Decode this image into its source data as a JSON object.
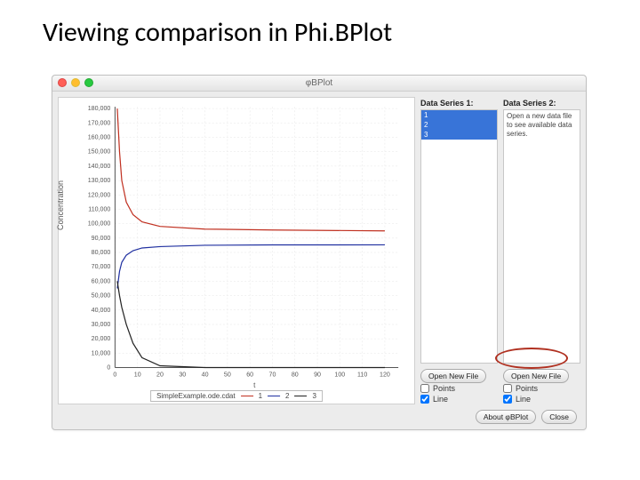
{
  "slide": {
    "title": "Viewing comparison in Phi.BPlot"
  },
  "window": {
    "title": "φBPlot"
  },
  "chart_data": {
    "type": "line",
    "title": "",
    "xlabel": "t",
    "ylabel": "Concentration",
    "xlim": [
      0,
      130
    ],
    "ylim": [
      0,
      180000
    ],
    "xticks": [
      0,
      10,
      20,
      30,
      40,
      50,
      60,
      70,
      80,
      90,
      100,
      110,
      120
    ],
    "yticks": [
      0,
      10,
      20,
      30,
      40,
      50,
      60,
      70,
      80,
      90,
      100,
      110,
      120,
      130,
      140,
      150,
      160,
      170,
      180
    ],
    "ytick_labels": [
      "0",
      "10,000",
      "20,000",
      "30,000",
      "40,000",
      "50,000",
      "60,000",
      "70,000",
      "80,000",
      "90,000",
      "100,000",
      "110,000",
      "120,000",
      "130,000",
      "140,000",
      "150,000",
      "160,000",
      "170,000",
      "180,000"
    ],
    "series": [
      {
        "name": "1",
        "color": "#c03020",
        "x": [
          1,
          2,
          3,
          5,
          8,
          12,
          20,
          40,
          70,
          120
        ],
        "y": [
          180000,
          150000,
          130000,
          115000,
          106000,
          101000,
          98000,
          96000,
          95500,
          95000
        ]
      },
      {
        "name": "2",
        "color": "#2030a0",
        "x": [
          1,
          2,
          3,
          5,
          8,
          12,
          20,
          40,
          70,
          120
        ],
        "y": [
          55000,
          67000,
          73000,
          78000,
          81000,
          83000,
          84000,
          85000,
          85200,
          85300
        ]
      },
      {
        "name": "3",
        "color": "#222222",
        "x": [
          1,
          2,
          3,
          5,
          8,
          12,
          20,
          40,
          70,
          120
        ],
        "y": [
          60000,
          50000,
          42000,
          30000,
          17000,
          7000,
          1000,
          0,
          0,
          0
        ]
      }
    ]
  },
  "legend": {
    "file": "SimpleExample.ode.cdat",
    "items": [
      "1",
      "2",
      "3"
    ]
  },
  "panel1": {
    "header": "Data Series 1:",
    "items": [
      "1",
      "2",
      "3"
    ],
    "open_btn": "Open New File",
    "points_label": "Points",
    "line_label": "Line",
    "points_checked": false,
    "line_checked": true
  },
  "panel2": {
    "header": "Data Series 2:",
    "hint": "Open a new data file to see available data series.",
    "open_btn": "Open New File",
    "points_label": "Points",
    "line_label": "Line",
    "points_checked": false,
    "line_checked": true
  },
  "footer": {
    "about": "About φBPlot",
    "close": "Close"
  }
}
